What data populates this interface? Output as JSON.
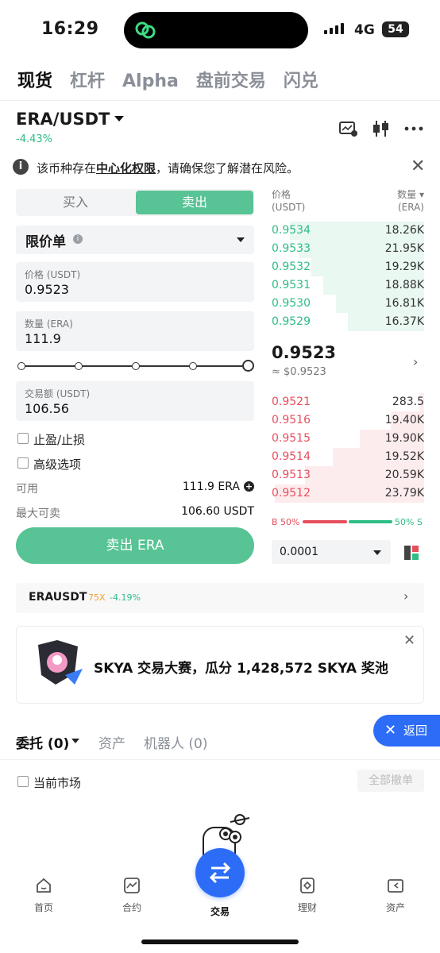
{
  "status_bar": {
    "time": "16:29",
    "network": "4G",
    "battery": "54"
  },
  "top_tabs": [
    {
      "label": "现货",
      "active": true
    },
    {
      "label": "杠杆",
      "active": false
    },
    {
      "label": "Alpha",
      "active": false
    },
    {
      "label": "盘前交易",
      "active": false
    },
    {
      "label": "闪兑",
      "active": false
    }
  ],
  "pair": {
    "symbol": "ERA/USDT",
    "change": "-4.43%"
  },
  "notice": {
    "prefix": "该币种存在",
    "link": "中心化权限",
    "suffix": "，请确保您了解潜在风险。"
  },
  "trade_form": {
    "buy_label": "买入",
    "sell_label": "卖出",
    "order_type": "限价单",
    "price_label": "价格 (USDT)",
    "price_value": "0.9523",
    "qty_label": "数量 (ERA)",
    "qty_value": "111.9",
    "slider_percent": 100,
    "amount_label": "交易额 (USDT)",
    "amount_value": "106.56",
    "tp_sl_label": "止盈/止损",
    "advanced_label": "高级选项",
    "available_label": "可用",
    "available_value": "111.9 ERA",
    "max_sell_label": "最大可卖",
    "max_sell_value": "106.60 USDT",
    "submit_label": "卖出 ERA"
  },
  "order_book": {
    "price_header": "价格",
    "price_unit": "(USDT)",
    "qty_header": "数量",
    "qty_unit": "(ERA)",
    "asks": [
      {
        "price": "0.9534",
        "qty": "18.26K",
        "depth": 0.88
      },
      {
        "price": "0.9533",
        "qty": "21.95K",
        "depth": 0.82
      },
      {
        "price": "0.9532",
        "qty": "19.29K",
        "depth": 0.74
      },
      {
        "price": "0.9531",
        "qty": "18.88K",
        "depth": 0.66
      },
      {
        "price": "0.9530",
        "qty": "16.81K",
        "depth": 0.58
      },
      {
        "price": "0.9529",
        "qty": "16.37K",
        "depth": 0.5
      }
    ],
    "mid_price": "0.9523",
    "mid_usd": "≈ $0.9523",
    "bids": [
      {
        "price": "0.9521",
        "qty": "283.5",
        "depth": 0.03
      },
      {
        "price": "0.9516",
        "qty": "19.40K",
        "depth": 0.22
      },
      {
        "price": "0.9515",
        "qty": "19.90K",
        "depth": 0.42
      },
      {
        "price": "0.9514",
        "qty": "19.52K",
        "depth": 0.6
      },
      {
        "price": "0.9513",
        "qty": "20.59K",
        "depth": 0.78
      },
      {
        "price": "0.9512",
        "qty": "23.79K",
        "depth": 0.98
      }
    ],
    "buy_ratio": "B 50%",
    "sell_ratio": "50% S",
    "depth_step": "0.0001"
  },
  "contract": {
    "name": "ERAUSDT",
    "leverage": "75X",
    "change": "-4.19%"
  },
  "banner": {
    "text": "SKYA 交易大赛，瓜分 1,428,572 SKYA 奖池"
  },
  "orders": {
    "tabs": [
      {
        "label": "委托 (0)",
        "active": true
      },
      {
        "label": "资产",
        "active": false
      },
      {
        "label": "机器人 (0)",
        "active": false
      }
    ],
    "current_market_label": "当前市场",
    "cancel_all_label": "全部撤单",
    "back_label": "返回"
  },
  "bottom_nav": [
    {
      "label": "首页",
      "icon": "home-icon"
    },
    {
      "label": "合约",
      "icon": "futures-icon"
    },
    {
      "label": "交易",
      "icon": "swap-arrows-icon"
    },
    {
      "label": "理财",
      "icon": "earn-icon"
    },
    {
      "label": "资产",
      "icon": "wallet-icon"
    }
  ],
  "colors": {
    "accent_green": "#58c394",
    "up_green": "#2ebd85",
    "down_red": "#e64f5e",
    "brand_blue": "#2c6cf6"
  }
}
